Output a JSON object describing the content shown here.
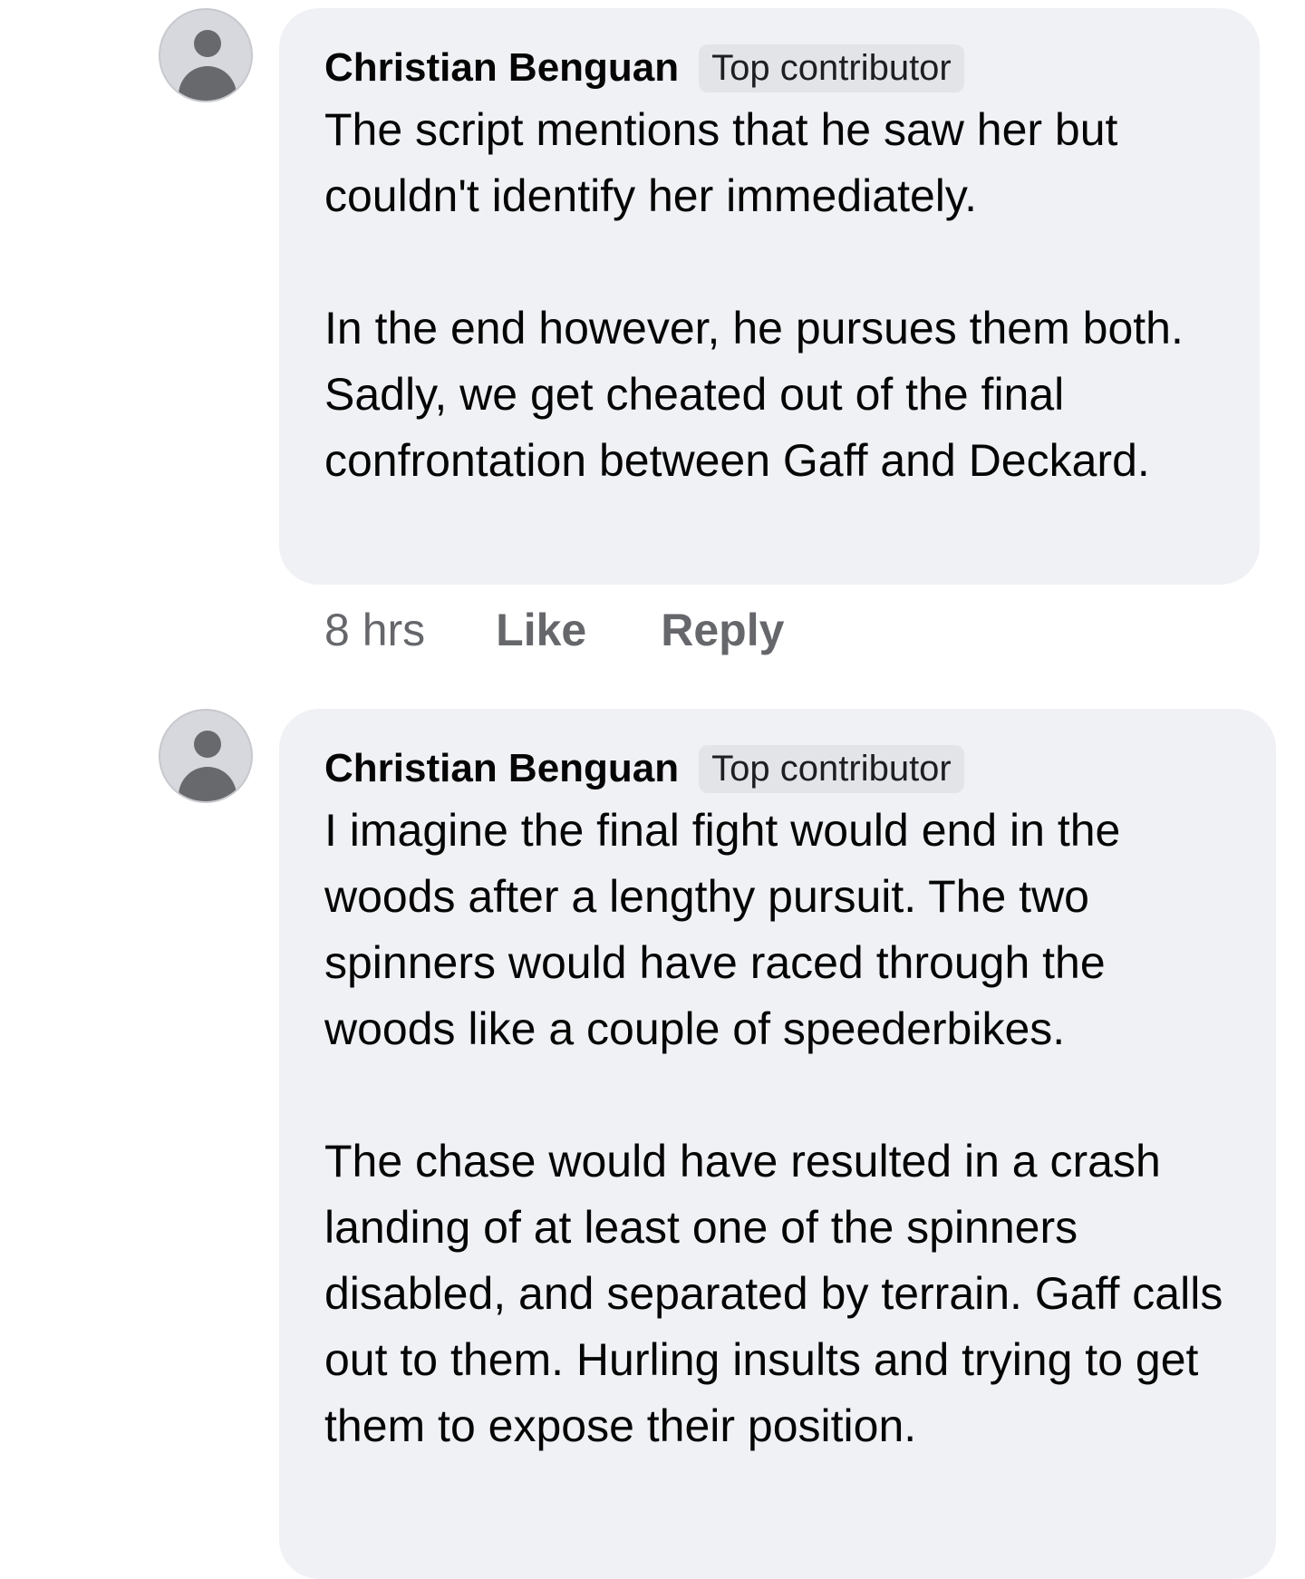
{
  "comments": [
    {
      "author": "Christian Benguan",
      "badge": "Top contributor",
      "text": "The script mentions that he saw her but couldn't identify her immediately.\n\nIn the end however, he pursues them both. Sadly, we get cheated out of the final confrontation between Gaff and Deckard.",
      "time": "8 hrs",
      "like_label": "Like",
      "reply_label": "Reply"
    },
    {
      "author": "Christian Benguan",
      "badge": "Top contributor",
      "text": "I imagine the final fight would end in the woods after a lengthy pursuit. The two spinners would have raced through the woods like a couple of speederbikes.\n\nThe chase would have resulted in a crash landing of at least one of the spinners disabled, and separated by terrain. Gaff calls out to them. Hurling insults and trying to get them to expose their position."
    }
  ],
  "icons": {
    "avatar": "default-profile-silhouette-icon"
  },
  "colors": {
    "bubble_background": "#f0f1f5",
    "badge_background": "#e3e4e8",
    "action_text": "#65676b",
    "body_text": "#050505"
  }
}
